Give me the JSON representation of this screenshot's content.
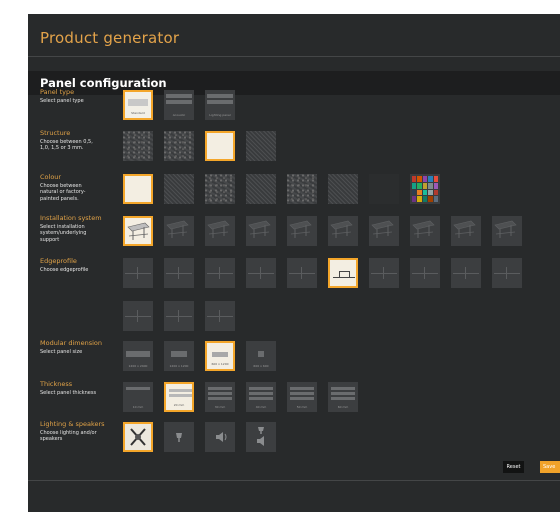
{
  "app": {
    "title": "Product generator",
    "panel_title": "Panel configuration",
    "accent_color": "#f4a62a",
    "title_color": "#e3a34a"
  },
  "sections": {
    "panel_type": {
      "title": "Panel type",
      "description": "Select panel type",
      "options": [
        "Standard",
        "Acoustic",
        "Lighting panel"
      ],
      "selected_index": 0
    },
    "structure": {
      "title": "Structure",
      "description": "Choose between 0,5,\n1,0, 1,5 or 3 mm.",
      "selected_index": 2
    },
    "colour": {
      "title": "Colour",
      "description": "Choose between\nnatural or factory-\npainted panels.",
      "selected_index": 0,
      "palette": [
        "#c0392b",
        "#d35400",
        "#8e44ad",
        "#2980b9",
        "#e74c3c",
        "#16a085",
        "#27ae60",
        "#c0a030",
        "#7f8c8d",
        "#9b59b6",
        "#2c3e50",
        "#e67e22",
        "#1abc9c",
        "#95a5a6",
        "#b03a2e",
        "#6c3483",
        "#d4ac0d",
        "#117a65",
        "#a04000",
        "#5d6d7e"
      ]
    },
    "installation": {
      "title": "Installation system",
      "description": "Select installation\nsystem/underlying\nsupport",
      "selected_index": 0
    },
    "edgeprofile": {
      "title": "Edgeprofile",
      "description": "Choose edgeprofile",
      "selected_index": 5
    },
    "modular": {
      "title": "Modular dimension",
      "description": "Select panel size",
      "options": [
        "1200 x 2400",
        "1200 x 1200",
        "600 x 1200",
        "600 x 600"
      ],
      "selected_index": 2
    },
    "thickness": {
      "title": "Thickness",
      "description": "Select panel thickness",
      "options": [
        "10 mm",
        "20 mm",
        "30 mm",
        "40 mm",
        "50 mm",
        "60 mm"
      ],
      "selected_index": 1
    },
    "lighting": {
      "title": "Lighting & speakers",
      "description": "Choose lighting and/or\nspeakers",
      "options": [
        "None",
        "Lighting",
        "Speakers",
        "Lighting and speakers"
      ],
      "selected_index": 0
    }
  },
  "buttons": {
    "reset": "Reset",
    "save": "Save"
  }
}
